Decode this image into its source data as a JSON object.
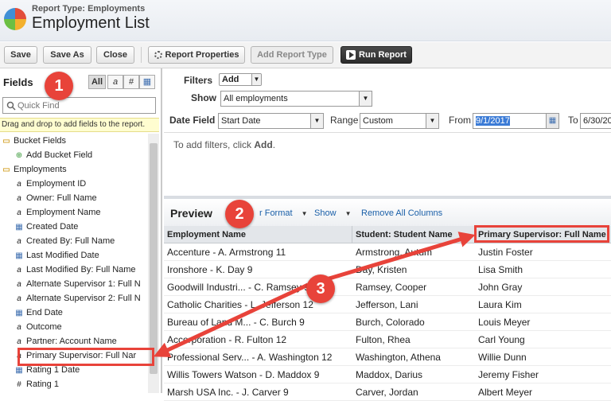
{
  "header": {
    "report_type": "Report Type: Employments",
    "title": "Employment List"
  },
  "toolbar": {
    "save": "Save",
    "save_as": "Save As",
    "close": "Close",
    "report_properties": "Report Properties",
    "add_report_type": "Add Report Type",
    "run_report": "Run Report"
  },
  "fields_panel": {
    "title": "Fields",
    "type_filters": [
      "All",
      "a",
      "#",
      "▦"
    ],
    "quick_find_placeholder": "Quick Find",
    "hint": "Drag and drop to add fields to the report.",
    "tree": [
      {
        "label": "Bucket Fields",
        "icon": "folder-icon",
        "level": 0
      },
      {
        "label": "Add Bucket Field",
        "icon": "add-bucket-icon",
        "level": 1
      },
      {
        "label": "Employments",
        "icon": "folder-icon",
        "level": 0
      },
      {
        "label": "Employment ID",
        "icon": "text-field-icon",
        "level": 1
      },
      {
        "label": "Owner: Full Name",
        "icon": "text-field-icon",
        "level": 1
      },
      {
        "label": "Employment Name",
        "icon": "text-field-icon",
        "level": 1
      },
      {
        "label": "Created Date",
        "icon": "date-field-icon",
        "level": 1
      },
      {
        "label": "Created By: Full Name",
        "icon": "text-field-icon",
        "level": 1
      },
      {
        "label": "Last Modified Date",
        "icon": "date-field-icon",
        "level": 1
      },
      {
        "label": "Last Modified By: Full Name",
        "icon": "text-field-icon",
        "level": 1
      },
      {
        "label": "Alternate Supervisor 1: Full N",
        "icon": "text-field-icon",
        "level": 1
      },
      {
        "label": "Alternate Supervisor 2: Full N",
        "icon": "text-field-icon",
        "level": 1
      },
      {
        "label": "End Date",
        "icon": "date-field-icon",
        "level": 1
      },
      {
        "label": "Outcome",
        "icon": "text-field-icon",
        "level": 1
      },
      {
        "label": "Partner: Account Name",
        "icon": "text-field-icon",
        "level": 1
      },
      {
        "label": "Primary Supervisor: Full Nar",
        "icon": "text-field-icon",
        "level": 1
      },
      {
        "label": "Rating 1 Date",
        "icon": "date-field-icon",
        "level": 1
      },
      {
        "label": "Rating 1",
        "icon": "number-field-icon",
        "level": 1
      }
    ]
  },
  "filters": {
    "filters_label": "Filters",
    "add_label": "Add",
    "show_label": "Show",
    "show_value": "All employments",
    "date_field_label": "Date Field",
    "date_field_value": "Start Date",
    "range_label": "Range",
    "range_value": "Custom",
    "from_label": "From",
    "from_value": "9/1/2017",
    "to_label": "To",
    "to_value": "6/30/20",
    "empty_text_prefix": "To add filters, click ",
    "empty_text_link": "Add",
    "empty_text_suffix": "."
  },
  "preview": {
    "title": "Preview",
    "format_label": "r Format",
    "show_label": "Show",
    "remove_all": "Remove All Columns",
    "columns": [
      "Employment Name",
      "Student: Student Name",
      "Primary Supervisor: Full Name"
    ],
    "rows": [
      [
        "Accenture - A. Armstrong 11",
        "Armstrong, Autum",
        "Justin Foster"
      ],
      [
        "Ironshore - K. Day 9",
        "Day, Kristen",
        "Lisa Smith"
      ],
      [
        "Goodwill Industri... - C. Ramsey 9",
        "Ramsey, Cooper",
        "John Gray"
      ],
      [
        "Catholic Charities - L. Jefferson 12",
        "Jefferson, Lani",
        "Laura Kim"
      ],
      [
        "Bureau of Land M... - C. Burch 9",
        "Burch, Colorado",
        "Louis Meyer"
      ],
      [
        "Accorporation - R. Fulton 12",
        "Fulton, Rhea",
        "Carl Young"
      ],
      [
        "Professional Serv... - A. Washington 12",
        "Washington, Athena",
        "Willie Dunn"
      ],
      [
        "Willis Towers Watson - D. Maddox 9",
        "Maddox, Darius",
        "Jeremy Fisher"
      ],
      [
        "Marsh USA Inc. - J. Carver 9",
        "Carver, Jordan",
        "Albert Meyer"
      ]
    ]
  },
  "callouts": [
    "1",
    "2",
    "3"
  ],
  "colors": {
    "accent_red": "#e8433a",
    "link_blue": "#1a5fa8",
    "hint_yellow": "#fffdd0"
  }
}
